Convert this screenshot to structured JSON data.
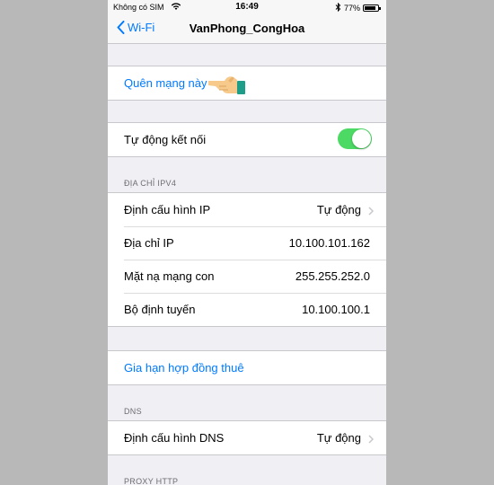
{
  "status_bar": {
    "carrier": "Không có SIM",
    "time": "16:49",
    "battery_percent": "77%"
  },
  "nav": {
    "back_label": "Wi-Fi",
    "title": "VanPhong_CongHoa"
  },
  "forget_network": {
    "label": "Quên mạng này"
  },
  "auto_join": {
    "label": "Tự động kết nối",
    "enabled": true
  },
  "ipv4": {
    "header": "ĐỊA CHỈ IPV4",
    "rows": [
      {
        "label": "Định cấu hình IP",
        "value": "Tự động",
        "chevron": true
      },
      {
        "label": "Địa chỉ IP",
        "value": "10.100.101.162"
      },
      {
        "label": "Mặt nạ mạng con",
        "value": "255.255.252.0"
      },
      {
        "label": "Bộ định tuyến",
        "value": "10.100.100.1"
      }
    ]
  },
  "renew_lease": {
    "label": "Gia hạn hợp đồng thuê"
  },
  "dns": {
    "header": "DNS",
    "configure": {
      "label": "Định cấu hình DNS",
      "value": "Tự động"
    }
  },
  "proxy": {
    "header": "PROXY HTTP"
  },
  "colors": {
    "accent": "#007aff",
    "toggle_on": "#4cd964",
    "background": "#efeff4"
  }
}
